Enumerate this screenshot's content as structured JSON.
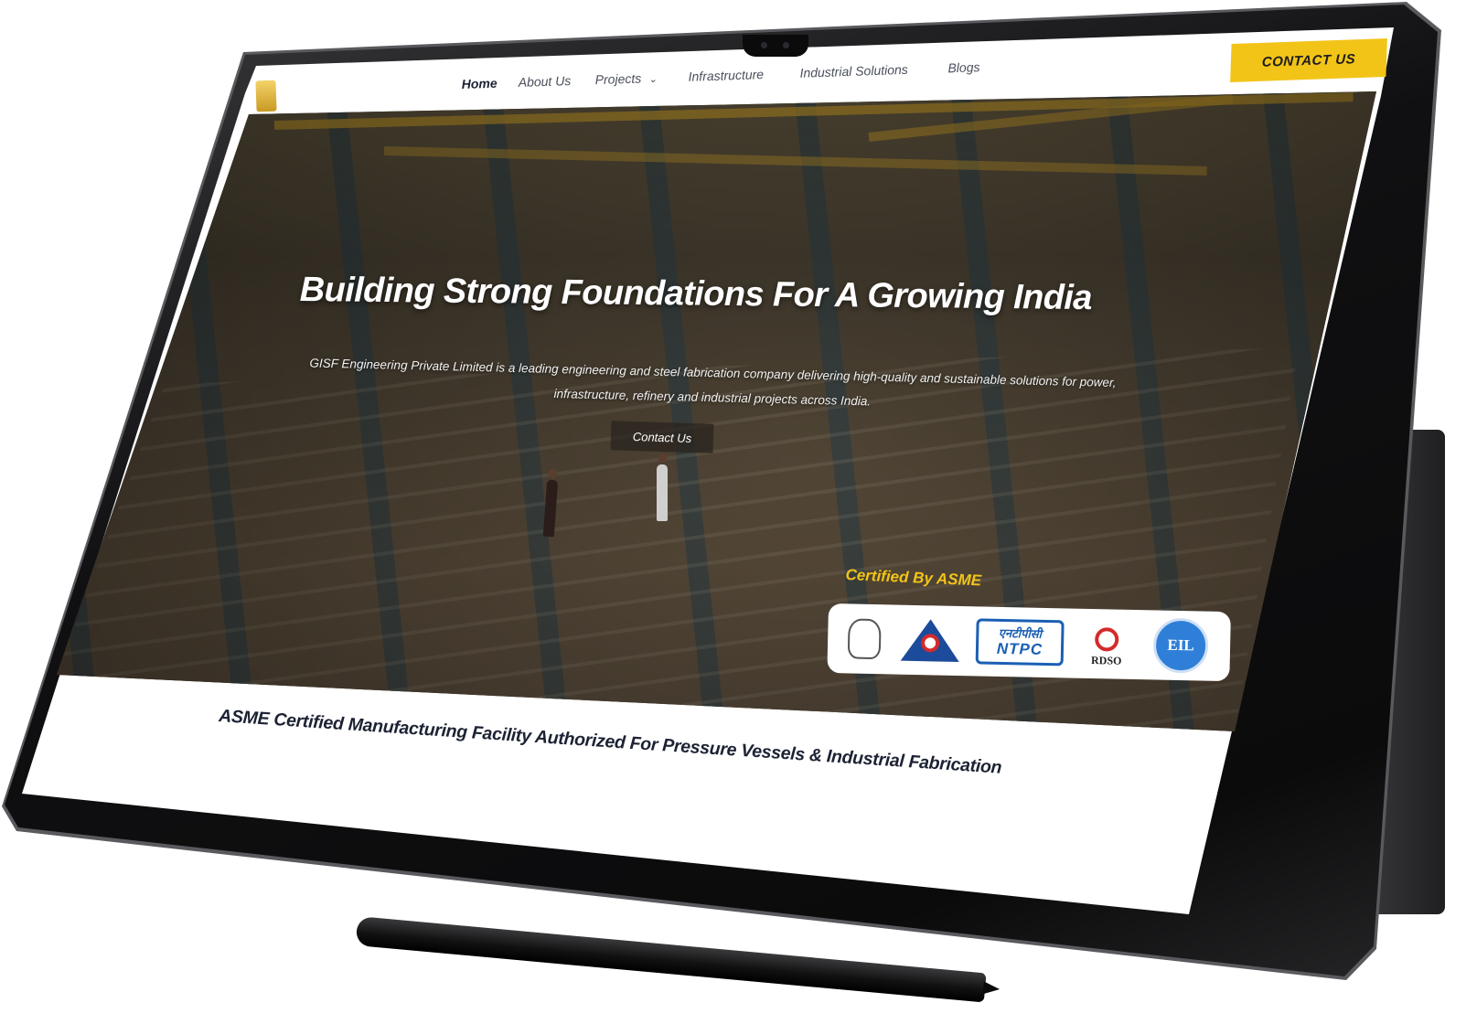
{
  "nav": {
    "items": [
      {
        "label": "Home",
        "active": true
      },
      {
        "label": "About Us",
        "active": false
      },
      {
        "label": "Projects",
        "active": false,
        "has_dropdown": true
      },
      {
        "label": "Infrastructure",
        "active": false
      },
      {
        "label": "Industrial Solutions",
        "active": false
      },
      {
        "label": "Blogs",
        "active": false
      }
    ],
    "dropdown_icon": "chevron-down-icon",
    "cta_label": "CONTACT US"
  },
  "hero": {
    "headline": "Building Strong Foundations For A Growing India",
    "description": "GISF Engineering Private Limited is a leading engineering and steel fabrication company delivering high-quality and sustainable solutions for power, infrastructure, refinery and industrial projects across India.",
    "button_label": "Contact Us",
    "cert_label": "Certified By ASME",
    "cert_logos": {
      "ntpc_hindi": "एनटीपीसी",
      "ntpc": "NTPC",
      "rdso": "RDSO",
      "eil": "EIL"
    }
  },
  "tagline": "ASME Certified Manufacturing Facility Authorized For Pressure Vessels & Industrial Fabrication",
  "colors": {
    "accent": "#f2c418",
    "nav_text": "#4a4f5c",
    "heading_text": "#1c2233"
  }
}
